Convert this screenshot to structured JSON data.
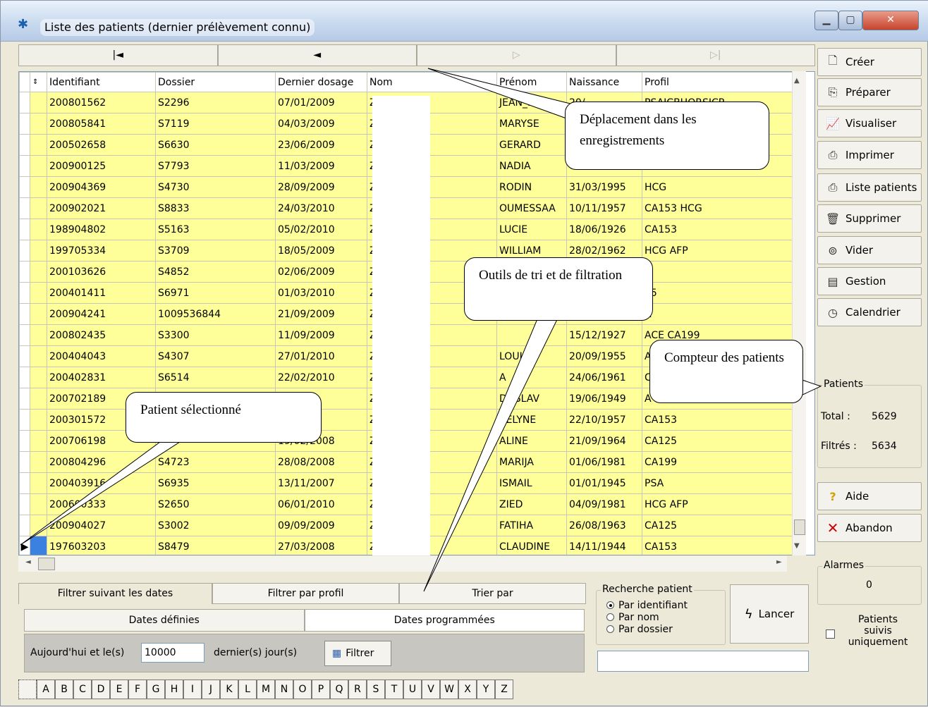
{
  "window": {
    "title": "Liste des patients (dernier prélèvement connu)"
  },
  "nav": [
    "|◄",
    "◄",
    "▷",
    "▷|"
  ],
  "columns": [
    "Identifiant",
    "Dossier",
    "Dernier dosage",
    "Nom",
    "Prénom",
    "Naissance",
    "Profil"
  ],
  "rows": [
    [
      "200801562",
      "S2296",
      "07/01/2009",
      "Z",
      "JEAN_MAR",
      "20/",
      "PSAICBHORSICR"
    ],
    [
      "200805841",
      "S7119",
      "04/03/2009",
      "Z        I",
      "MARYSE",
      "",
      ""
    ],
    [
      "200502658",
      "S6630",
      "23/06/2009",
      "Z",
      "GERARD",
      "",
      ""
    ],
    [
      "200900125",
      "S7793",
      "11/03/2009",
      "Z",
      "NADIA",
      "0",
      ""
    ],
    [
      "200904369",
      "S4730",
      "28/09/2009",
      "Z           OME",
      "RODIN",
      "31/03/1995",
      "HCG"
    ],
    [
      "200902021",
      "S8833",
      "24/03/2010",
      "Z",
      "OUMESSAA",
      "10/11/1957",
      "CA153 HCG"
    ],
    [
      "198904802",
      "S5163",
      "05/02/2010",
      "Z",
      "LUCIE",
      "18/06/1926",
      "CA153"
    ],
    [
      "199705334",
      "S3709",
      "18/05/2009",
      "Z",
      "WILLIAM",
      "28/02/1962",
      "HCG AFP"
    ],
    [
      "200103626",
      "S4852",
      "02/06/2009",
      "Z",
      "",
      "",
      "A"
    ],
    [
      "200401411",
      "S6971",
      "01/03/2010",
      "Z",
      "",
      "",
      "25"
    ],
    [
      "200904241",
      "1009536844",
      "21/09/2009",
      "Z",
      "",
      "",
      "A"
    ],
    [
      "200802435",
      "S3300",
      "11/09/2009",
      "Z",
      "",
      "15/12/1927",
      "ACE CA199"
    ],
    [
      "200404043",
      "S4307",
      "27/01/2010",
      "Z",
      "LOUIS",
      "20/09/1955",
      "A"
    ],
    [
      "200402831",
      "S6514",
      "22/02/2010",
      "Z",
      "A",
      "24/06/1961",
      "C"
    ],
    [
      "200702189",
      "",
      "007",
      "Z",
      "DOSLAV",
      "19/06/1949",
      "A"
    ],
    [
      "200301572",
      "",
      "009",
      "Z            O",
      "VELYNE",
      "22/10/1957",
      "CA153"
    ],
    [
      "200706198",
      "",
      "19/02/2008",
      "Z",
      "ALINE",
      "21/09/1964",
      "CA125"
    ],
    [
      "200804296",
      "S4723",
      "28/08/2008",
      "Z",
      "MARIJA",
      "01/06/1981",
      "CA199"
    ],
    [
      "200403916",
      "S6935",
      "13/11/2007",
      "Z",
      "ISMAIL",
      "01/01/1945",
      "PSA"
    ],
    [
      "200600333",
      "S2650",
      "06/01/2010",
      "Z",
      "ZIED",
      "04/09/1981",
      "HCG AFP"
    ],
    [
      "200904027",
      "S3002",
      "09/09/2009",
      "Z",
      "FATIHA",
      "26/08/1963",
      "CA125"
    ],
    [
      "197603203",
      "S8479",
      "27/03/2008",
      "Z             I",
      "CLAUDINE",
      "14/11/1944",
      "CA153"
    ]
  ],
  "side_buttons": [
    {
      "label": "Créer",
      "icon": "new-file-icon",
      "glyph": "🗋"
    },
    {
      "label": "Préparer",
      "icon": "prepare-icon",
      "glyph": "⎘"
    },
    {
      "label": "Visualiser",
      "icon": "chart-icon",
      "glyph": "📈"
    },
    {
      "label": "Imprimer",
      "icon": "printer-icon",
      "glyph": "⎙"
    },
    {
      "label": "Liste patients",
      "icon": "printer-icon",
      "glyph": "⎙"
    },
    {
      "label": "Supprimer",
      "icon": "trash-icon",
      "glyph": "🗑"
    },
    {
      "label": "Vider",
      "icon": "empty-icon",
      "glyph": "⊚"
    },
    {
      "label": "Gestion",
      "icon": "manage-icon",
      "glyph": "▤"
    },
    {
      "label": "Calendrier",
      "icon": "calendar-icon",
      "glyph": "◷"
    }
  ],
  "patients": {
    "label": "Patients",
    "total_label": "Total :",
    "total": "5629",
    "filtered_label": "Filtrés :",
    "filtered": "5634"
  },
  "help_label": "Aide",
  "cancel_label": "Abandon",
  "alarms": {
    "label": "Alarmes",
    "value": "0"
  },
  "followed_label": "Patients suivis uniquement",
  "tabs": [
    "Filtrer suivant les dates",
    "Filtrer par profil",
    "Trier par"
  ],
  "subtabs": [
    "Dates définies",
    "Dates programmées"
  ],
  "filter": {
    "prefix": "Aujourd'hui et le(s)",
    "days": "10000",
    "suffix": "dernier(s) jour(s)",
    "button": "Filtrer"
  },
  "search": {
    "label": "Recherche patient",
    "options": [
      "Par identifiant",
      "Par nom",
      "Par dossier"
    ],
    "launch": "Lancer"
  },
  "alphabet": [
    "A",
    "B",
    "C",
    "D",
    "E",
    "F",
    "G",
    "H",
    "I",
    "J",
    "K",
    "L",
    "M",
    "N",
    "O",
    "P",
    "Q",
    "R",
    "S",
    "T",
    "U",
    "V",
    "W",
    "X",
    "Y",
    "Z"
  ],
  "callouts": {
    "navigation": "Déplacement dans les enregistrements",
    "sorting": "Outils de tri et de filtration",
    "counter": "Compteur des patients",
    "selected": "Patient sélectionné"
  },
  "colors": {
    "row": "#ffff99",
    "selected": "#3b82e0"
  }
}
